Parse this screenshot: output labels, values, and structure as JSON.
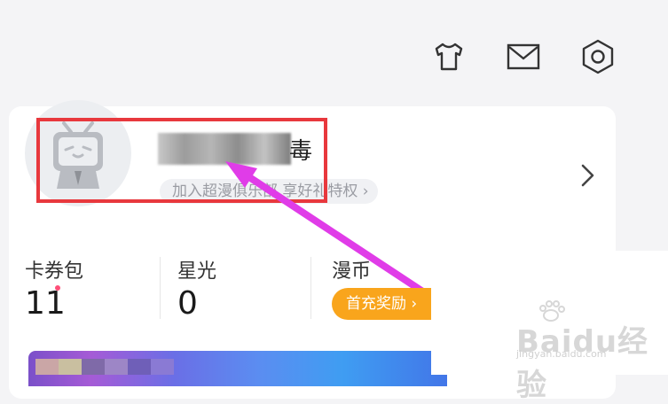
{
  "colors": {
    "accent_red": "#e8383d",
    "arrow_magenta": "#e03ce8",
    "promo_orange": "#f9a51c",
    "badge_pink": "#ff4f78"
  },
  "header": {
    "icons": [
      "tshirt-icon",
      "mail-icon",
      "settings-icon"
    ]
  },
  "profile": {
    "name_visible_char": "毒",
    "club_link": "加入超漫俱乐部 享好礼特权 ›"
  },
  "stats": [
    {
      "label": "卡券包",
      "value": "11"
    },
    {
      "label": "星光",
      "value": "0"
    },
    {
      "label": "漫币",
      "promo": "首充奖励 ›"
    }
  ],
  "watermark": {
    "brand": "Baidu经验",
    "url": "jingyan.baidu.com"
  }
}
